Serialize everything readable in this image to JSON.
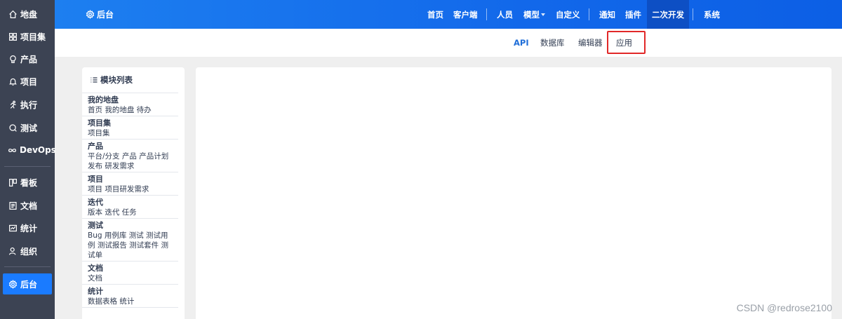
{
  "sidebar": {
    "items": [
      {
        "label": "地盘",
        "icon": "home-icon"
      },
      {
        "label": "项目集",
        "icon": "grid-icon"
      },
      {
        "label": "产品",
        "icon": "lightbulb-icon"
      },
      {
        "label": "项目",
        "icon": "bell-icon"
      },
      {
        "label": "执行",
        "icon": "run-icon"
      },
      {
        "label": "测试",
        "icon": "search-icon"
      },
      {
        "label": "DevOps",
        "icon": "infinity-icon"
      },
      {
        "label": "看板",
        "icon": "kanban-icon"
      },
      {
        "label": "文档",
        "icon": "doc-icon"
      },
      {
        "label": "统计",
        "icon": "chart-icon"
      },
      {
        "label": "组织",
        "icon": "people-icon"
      },
      {
        "label": "后台",
        "icon": "gear-icon"
      }
    ],
    "active": "后台"
  },
  "topbar": {
    "brand": "后台",
    "menu": [
      "首页",
      "客户端",
      "人员",
      "模型",
      "自定义",
      "通知",
      "插件",
      "二次开发",
      "系统"
    ],
    "active": "二次开发"
  },
  "subnav": {
    "items": [
      "API",
      "数据库",
      "编辑器",
      "应用"
    ],
    "active": "API",
    "highlighted": "应用"
  },
  "modules": {
    "title": "模块列表",
    "groups": [
      {
        "title": "我的地盘",
        "items": "首页 我的地盘 待办"
      },
      {
        "title": "项目集",
        "items": "项目集"
      },
      {
        "title": "产品",
        "items": "平台/分支 产品 产品计划 发布 研发需求"
      },
      {
        "title": "项目",
        "items": "项目 项目研发需求"
      },
      {
        "title": "迭代",
        "items": "版本 迭代 任务"
      },
      {
        "title": "测试",
        "items": "Bug 用例库 测试 测试用例 测试报告 测试套件 测试单"
      },
      {
        "title": "文档",
        "items": "文档"
      },
      {
        "title": "统计",
        "items": "数据表格 统计"
      }
    ]
  },
  "watermark": "CSDN @redrose2100"
}
